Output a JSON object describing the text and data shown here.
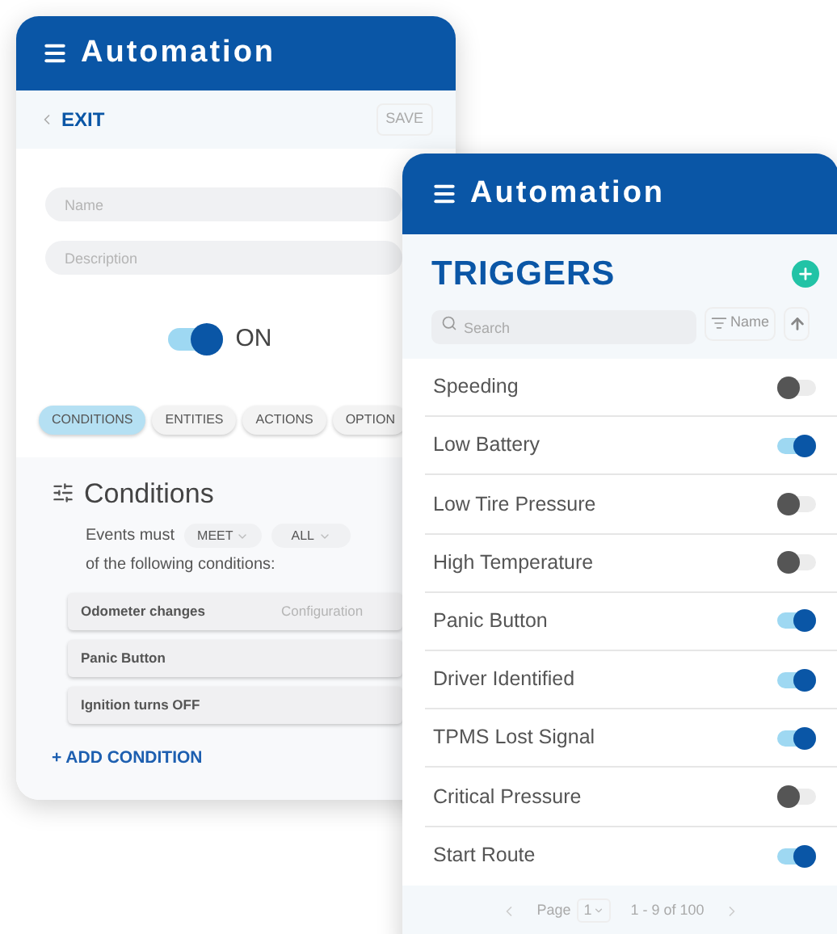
{
  "editor": {
    "title": "Automation",
    "back": "EXIT",
    "save": "SAVE",
    "name_field": {
      "placeholder": "Name"
    },
    "description_field": {
      "placeholder": "Description"
    },
    "status": {
      "on": true,
      "label": "ON"
    },
    "tabs": [
      {
        "label": "CONDITIONS",
        "selected": true
      },
      {
        "label": "ENTITIES",
        "selected": false
      },
      {
        "label": "ACTIONS",
        "selected": false
      },
      {
        "label": "OPTION",
        "selected": false
      }
    ],
    "conditions": {
      "title": "Conditions",
      "prefix": "Events must",
      "meet": "MEET",
      "all": "ALL",
      "suffix": "of the following conditions:",
      "items": [
        {
          "label": "Odometer changes",
          "detail": "Configuration"
        },
        {
          "label": "Panic Button"
        },
        {
          "label": "Ignition turns OFF"
        }
      ],
      "add": "+ ADD CONDITION"
    }
  },
  "triggers_panel": {
    "title": "Automation",
    "heading": "TRIGGERS",
    "search": {
      "placeholder": "Search"
    },
    "sort": "Name",
    "triggers": [
      {
        "label": "Speeding",
        "on": false
      },
      {
        "label": "Low Battery",
        "on": true
      },
      {
        "label": "Low Tire Pressure",
        "on": false
      },
      {
        "label": "High Temperature",
        "on": false
      },
      {
        "label": "Panic Button",
        "on": true
      },
      {
        "label": "Driver Identified",
        "on": true
      },
      {
        "label": "TPMS Lost Signal",
        "on": true
      },
      {
        "label": "Critical Pressure",
        "on": false
      },
      {
        "label": "Start Route",
        "on": true
      }
    ],
    "pagination": {
      "label": "Page",
      "page": "1",
      "range": "1 - 9 of 100"
    }
  }
}
